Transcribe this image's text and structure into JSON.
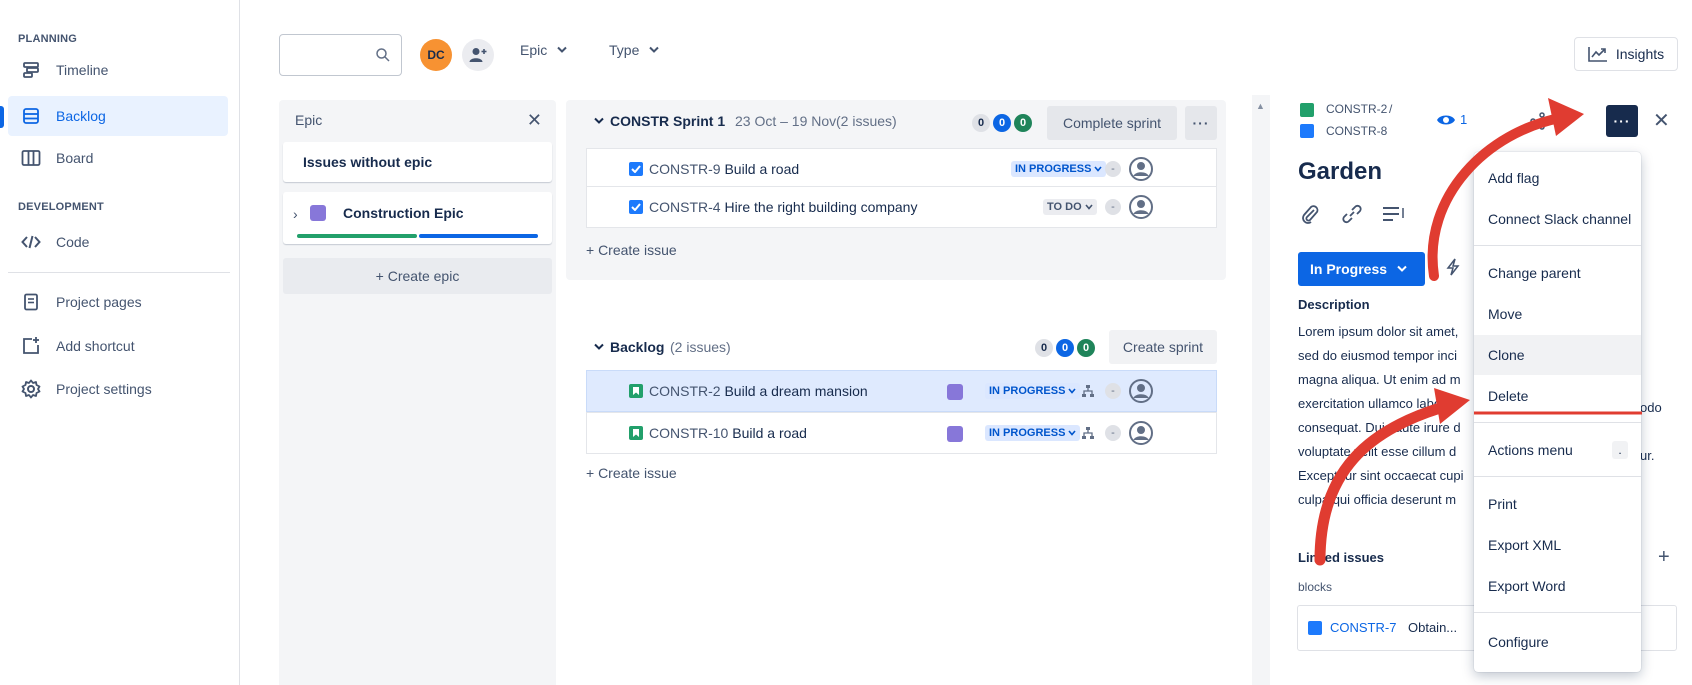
{
  "sidebar": {
    "planning_label": "PLANNING",
    "development_label": "DEVELOPMENT",
    "items": [
      {
        "label": "Timeline",
        "icon": "timeline-icon"
      },
      {
        "label": "Backlog",
        "icon": "backlog-icon",
        "active": true
      },
      {
        "label": "Board",
        "icon": "board-icon"
      },
      {
        "label": "Code",
        "icon": "code-icon"
      },
      {
        "label": "Project pages",
        "icon": "page-icon"
      },
      {
        "label": "Add shortcut",
        "icon": "add-shortcut-icon"
      },
      {
        "label": "Project settings",
        "icon": "gear-icon"
      }
    ]
  },
  "toolbar": {
    "search_placeholder": "",
    "avatar_initials": "DC",
    "epic_filter": "Epic",
    "type_filter": "Type",
    "insights_label": "Insights"
  },
  "epic_panel": {
    "title": "Epic",
    "without_epic": "Issues without epic",
    "epic_name": "Construction Epic",
    "create_epic": "+ Create epic"
  },
  "sprint": {
    "name": "CONSTR Sprint 1",
    "dates": "23 Oct – 19 Nov",
    "issue_count": "(2 issues)",
    "counts": [
      "0",
      "0",
      "0"
    ],
    "complete_label": "Complete sprint",
    "issues": [
      {
        "key": "CONSTR-9",
        "summary": "Build a road",
        "status": "IN PROGRESS"
      },
      {
        "key": "CONSTR-4",
        "summary": "Hire the right building company",
        "status": "TO DO"
      }
    ],
    "create_issue": "+ Create issue"
  },
  "backlog": {
    "name": "Backlog",
    "issue_count": "(2 issues)",
    "counts": [
      "0",
      "0",
      "0"
    ],
    "create_sprint": "Create sprint",
    "issues": [
      {
        "key": "CONSTR-2",
        "summary": "Build a dream mansion",
        "status": "IN PROGRESS"
      },
      {
        "key": "CONSTR-10",
        "summary": "Build a road",
        "status": "IN PROGRESS"
      }
    ],
    "create_issue": "+ Create issue"
  },
  "detail": {
    "parent_key": "CONSTR-2",
    "separator": "/",
    "issue_key": "CONSTR-8",
    "watchers": "1",
    "title": "Garden",
    "status_button": "In Progress",
    "description_label": "Description",
    "description_lines": [
      "Lorem ipsum dolor sit amet,",
      "sed do eiusmod tempor inci",
      "magna aliqua. Ut enim ad m",
      "exercitation ullamco labor",
      "consequat. Duis aute irure d",
      "voluptate velit esse cillum d",
      "Excepteur sint occaecat cupi",
      "culpa qui officia deserunt m"
    ],
    "desc_right_fragments": [
      "odo",
      "ur."
    ],
    "linked_label": "Linked issues",
    "blocks_label": "blocks",
    "linked_key": "CONSTR-7",
    "linked_summary": "Obtain...",
    "add_label": "+"
  },
  "menu": {
    "items": [
      "Add flag",
      "Connect Slack channel",
      "Change parent",
      "Move",
      "Clone",
      "Delete",
      "Actions menu",
      "Print",
      "Export XML",
      "Export Word",
      "Configure"
    ],
    "shortcut": "."
  },
  "colors": {
    "accent": "#0c66e4",
    "annotation": "#e03c31",
    "epic_purple": "#8777d9"
  }
}
